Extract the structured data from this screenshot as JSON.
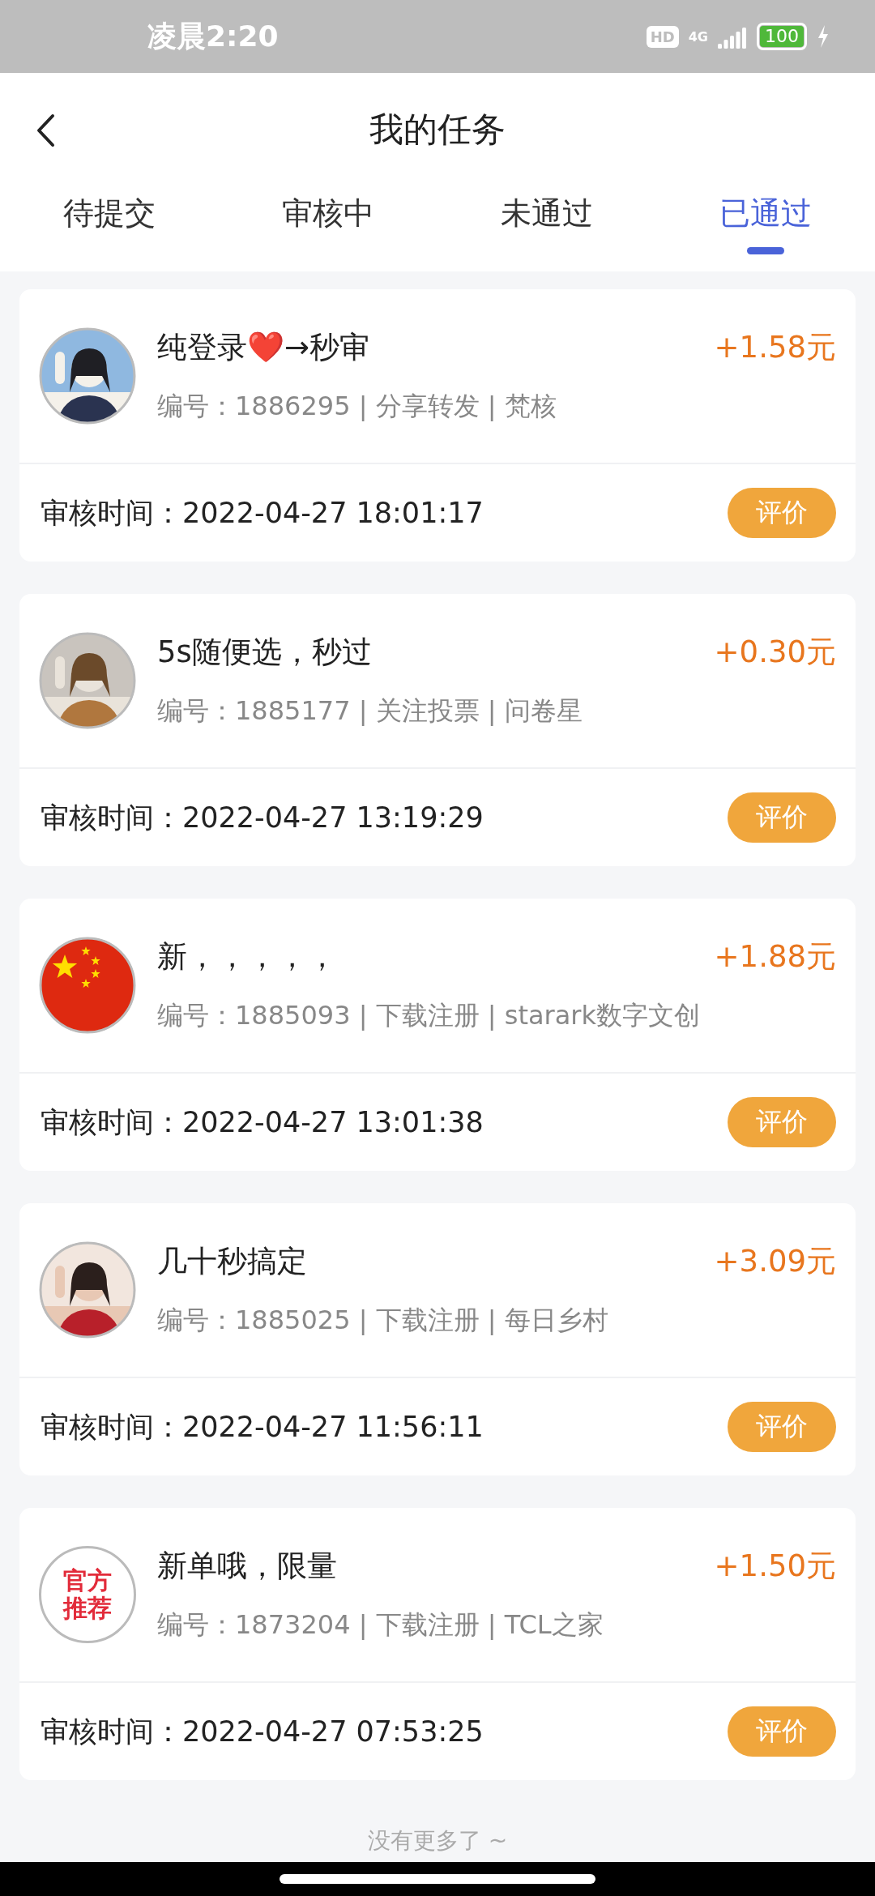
{
  "status_bar": {
    "time": "凌晨2:20",
    "hd": "HD",
    "network": "4G",
    "battery": "100"
  },
  "header": {
    "title": "我的任务"
  },
  "tabs": [
    {
      "label": "待提交",
      "selected": false
    },
    {
      "label": "审核中",
      "selected": false
    },
    {
      "label": "未通过",
      "selected": false
    },
    {
      "label": "已通过",
      "selected": true
    }
  ],
  "tasks": [
    {
      "title": "纯登录❤️→秒审",
      "price": "+1.58元",
      "meta": "编号：1886295 | 分享转发 | 梵核",
      "time_label": "审核时间：",
      "time": "2022-04-27 18:01:17",
      "button": "评价"
    },
    {
      "title": "5s随便选，秒过",
      "price": "+0.30元",
      "meta": "编号：1885177 | 关注投票 | 问卷星",
      "time_label": "审核时间：",
      "time": "2022-04-27 13:19:29",
      "button": "评价"
    },
    {
      "avatar": {
        "kind": "flag"
      },
      "title": "新，，，，，",
      "price": "+1.88元",
      "meta": "编号：1885093 | 下载注册 | starark数字文创",
      "time_label": "审核时间：",
      "time": "2022-04-27 13:01:38",
      "button": "评价"
    },
    {
      "title": "几十秒搞定",
      "price": "+3.09元",
      "meta": "编号：1885025 | 下载注册 | 每日乡村",
      "time_label": "审核时间：",
      "time": "2022-04-27 11:56:11",
      "button": "评价"
    },
    {
      "avatar": {
        "kind": "badge",
        "lines": [
          "官方",
          "推荐"
        ]
      },
      "title": "新单哦，限量",
      "price": "+1.50元",
      "meta": "编号：1873204 | 下载注册 | TCL之家",
      "time_label": "审核时间：",
      "time": "2022-04-27 07:53:25",
      "button": "评价"
    }
  ],
  "footer": "没有更多了 ~"
}
